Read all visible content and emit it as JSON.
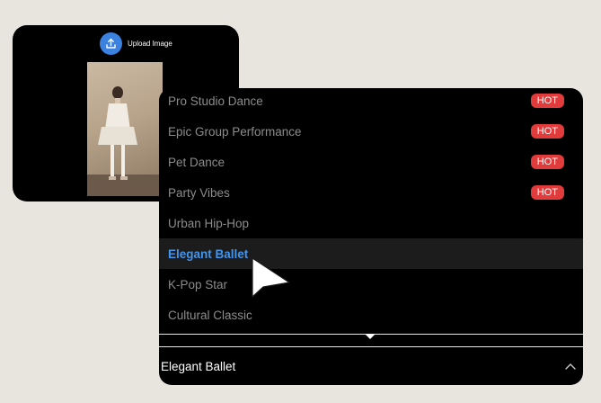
{
  "upload": {
    "button_label": "Upload Image",
    "icon": "upload-icon"
  },
  "dropdown": {
    "items": [
      {
        "label": "Pro Studio Dance",
        "badge": "HOT"
      },
      {
        "label": "Epic Group Performance",
        "badge": "HOT"
      },
      {
        "label": "Pet Dance",
        "badge": "HOT"
      },
      {
        "label": "Party Vibes",
        "badge": "HOT"
      },
      {
        "label": "Urban Hip-Hop",
        "badge": ""
      },
      {
        "label": "Elegant Ballet",
        "badge": ""
      },
      {
        "label": "K-Pop Star",
        "badge": ""
      },
      {
        "label": "Cultural Classic",
        "badge": ""
      }
    ],
    "selected_index": 5,
    "selected_value": "Elegant Ballet"
  },
  "colors": {
    "background": "#e8e5de",
    "panel": "#000000",
    "accent_blue": "#3f95f0",
    "hot_red": "#e23b3b",
    "muted_text": "#8c8c8c"
  }
}
